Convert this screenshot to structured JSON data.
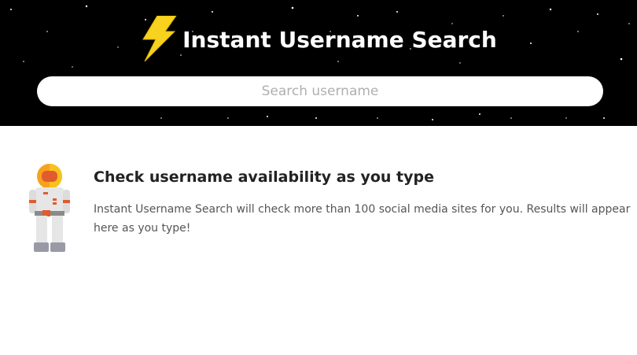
{
  "header": {
    "title": "Instant Username Search",
    "logo_icon": "lightning-bolt-icon",
    "accent_color": "#f7d21e",
    "background_color": "#000000"
  },
  "search": {
    "placeholder": "Search username",
    "value": ""
  },
  "info": {
    "illustration_icon": "astronaut-icon",
    "title": "Check username availability as you type",
    "description": "Instant Username Search will check more than 100 social media sites for you. Results will appear here as you type!"
  }
}
